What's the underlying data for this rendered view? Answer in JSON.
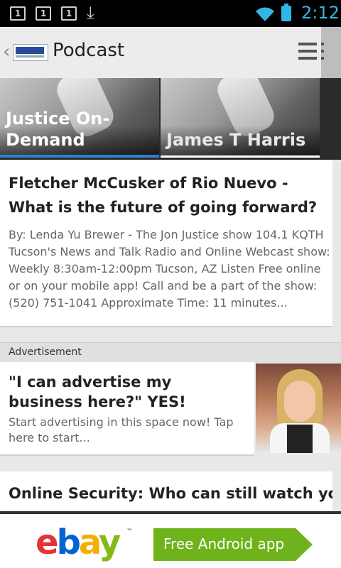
{
  "status_bar": {
    "notifications": [
      "1",
      "1",
      "1"
    ],
    "time": "2:12"
  },
  "action_bar": {
    "title": "Podcast"
  },
  "tabs": [
    {
      "label": "Justice On-Demand",
      "selected": true
    },
    {
      "label": "James T Harris",
      "selected": false
    }
  ],
  "articles": [
    {
      "title": "Fletcher McCusker of Rio Nuevo - What is the future of going forward?",
      "body": "By: Lenda Yu Brewer - The Jon Justice show 104.1 KQTH Tucson's News and Talk Radio and Online Webcast show: Weekly 8:30am-12:00pm Tucson, AZ Listen Free online or on your mobile app! Call and be a part of the show: (520) 751-1041 Approximate Time: 11 minutes..."
    },
    {
      "title": "Online Security: Who can still watch you - ..."
    }
  ],
  "ad_section": {
    "label": "Advertisement",
    "title": "\"I can advertise my business here?\" YES!",
    "body": "Start advertising in this space now! Tap here to start..."
  },
  "banner_ad": {
    "brand": "ebay",
    "cta": "Free Android app"
  },
  "colors": {
    "accent_blue": "#33b5e5",
    "tab_indicator": "#2f7fd0",
    "cta_green": "#6fb31c"
  }
}
